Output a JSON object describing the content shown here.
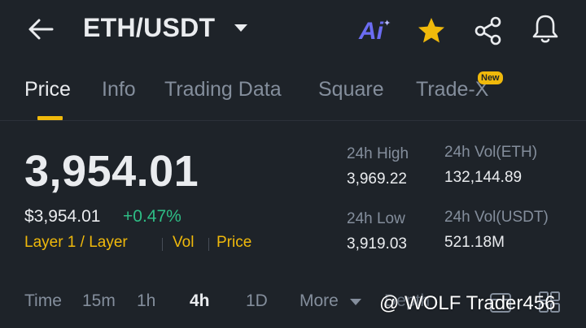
{
  "header": {
    "pair": "ETH/USDT",
    "ai_label": "Ai"
  },
  "tabs": [
    {
      "label": "Price",
      "active": true
    },
    {
      "label": "Info"
    },
    {
      "label": "Trading Data"
    },
    {
      "label": "Square"
    },
    {
      "label": "Trade-X",
      "badge": "New"
    }
  ],
  "price": {
    "last": "3,954.01",
    "usd": "$3,954.01",
    "change": "+0.47%",
    "tags": [
      "Layer 1 / Layer",
      "Vol",
      "Price"
    ]
  },
  "stats": {
    "high_label": "24h High",
    "high_value": "3,969.22",
    "low_label": "24h Low",
    "low_value": "3,919.03",
    "vol_eth_label": "24h Vol(ETH)",
    "vol_eth_value": "132,144.89",
    "vol_usdt_label": "24h Vol(USDT)",
    "vol_usdt_value": "521.18M"
  },
  "timeframes": {
    "items": [
      "Time",
      "15m",
      "1h",
      "4h",
      "1D",
      "More",
      "Depth"
    ],
    "active": "4h"
  },
  "watermark": "@ WOLF Trader456",
  "colors": {
    "background": "#1e2329",
    "accent": "#f0b90b",
    "positive": "#2ebd85",
    "muted": "#848e9c"
  }
}
